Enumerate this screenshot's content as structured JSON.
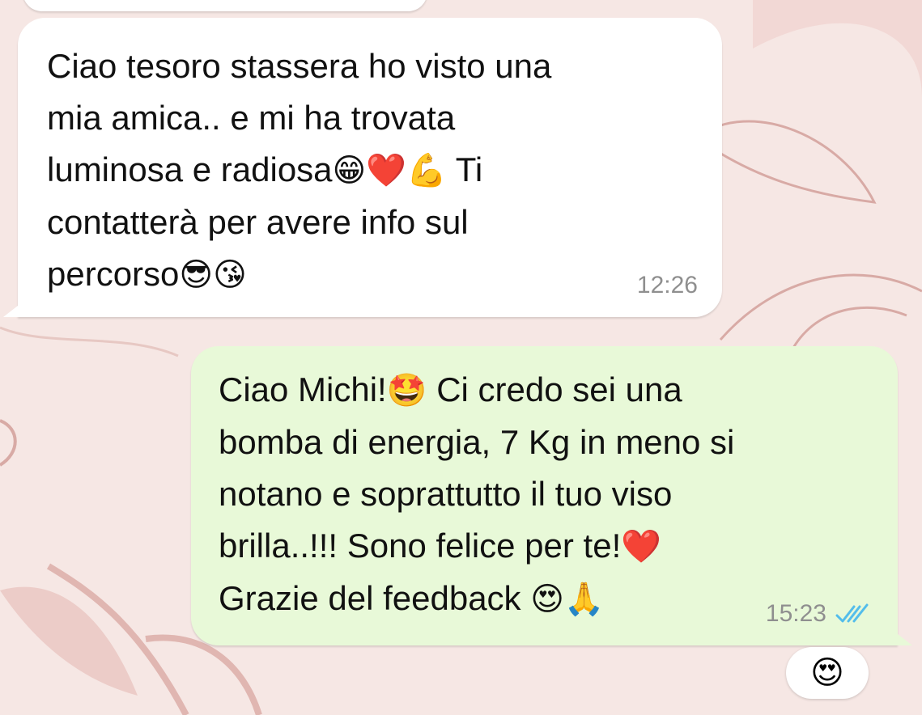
{
  "chat": {
    "incoming_message": {
      "lines": [
        "Ciao tesoro stassera ho visto una",
        "mia amica.. e mi ha trovata",
        "luminosa e radiosa",
        "contatterà per avere info sul",
        "percorso"
      ],
      "line3_after_emojis": " Ti",
      "time": "12:26",
      "emojis": {
        "grin": "😁",
        "heart": "❤️",
        "muscle": "💪",
        "sunglasses": "😎",
        "kiss": "😘"
      }
    },
    "outgoing_message": {
      "line1_before": "Ciao Michi!",
      "line1_after": " Ci credo sei una",
      "lines": [
        "bomba di energia, 7 Kg in meno si",
        "notano e soprattutto il tuo viso",
        "brilla..!!! Sono felice per te!",
        "Grazie del feedback "
      ],
      "time": "15:23",
      "emojis": {
        "star_eyes": "🤩",
        "heart": "❤️",
        "heart_eyes": "😍",
        "pray": "🙏"
      },
      "status_icon": "double-check-read-icon",
      "status_color": "#53bdeb"
    },
    "reaction": {
      "emoji": "😍"
    },
    "colors": {
      "incoming_bubble": "#ffffff",
      "outgoing_bubble": "#e8f9d8",
      "wallpaper": "#f6e7e4"
    }
  }
}
